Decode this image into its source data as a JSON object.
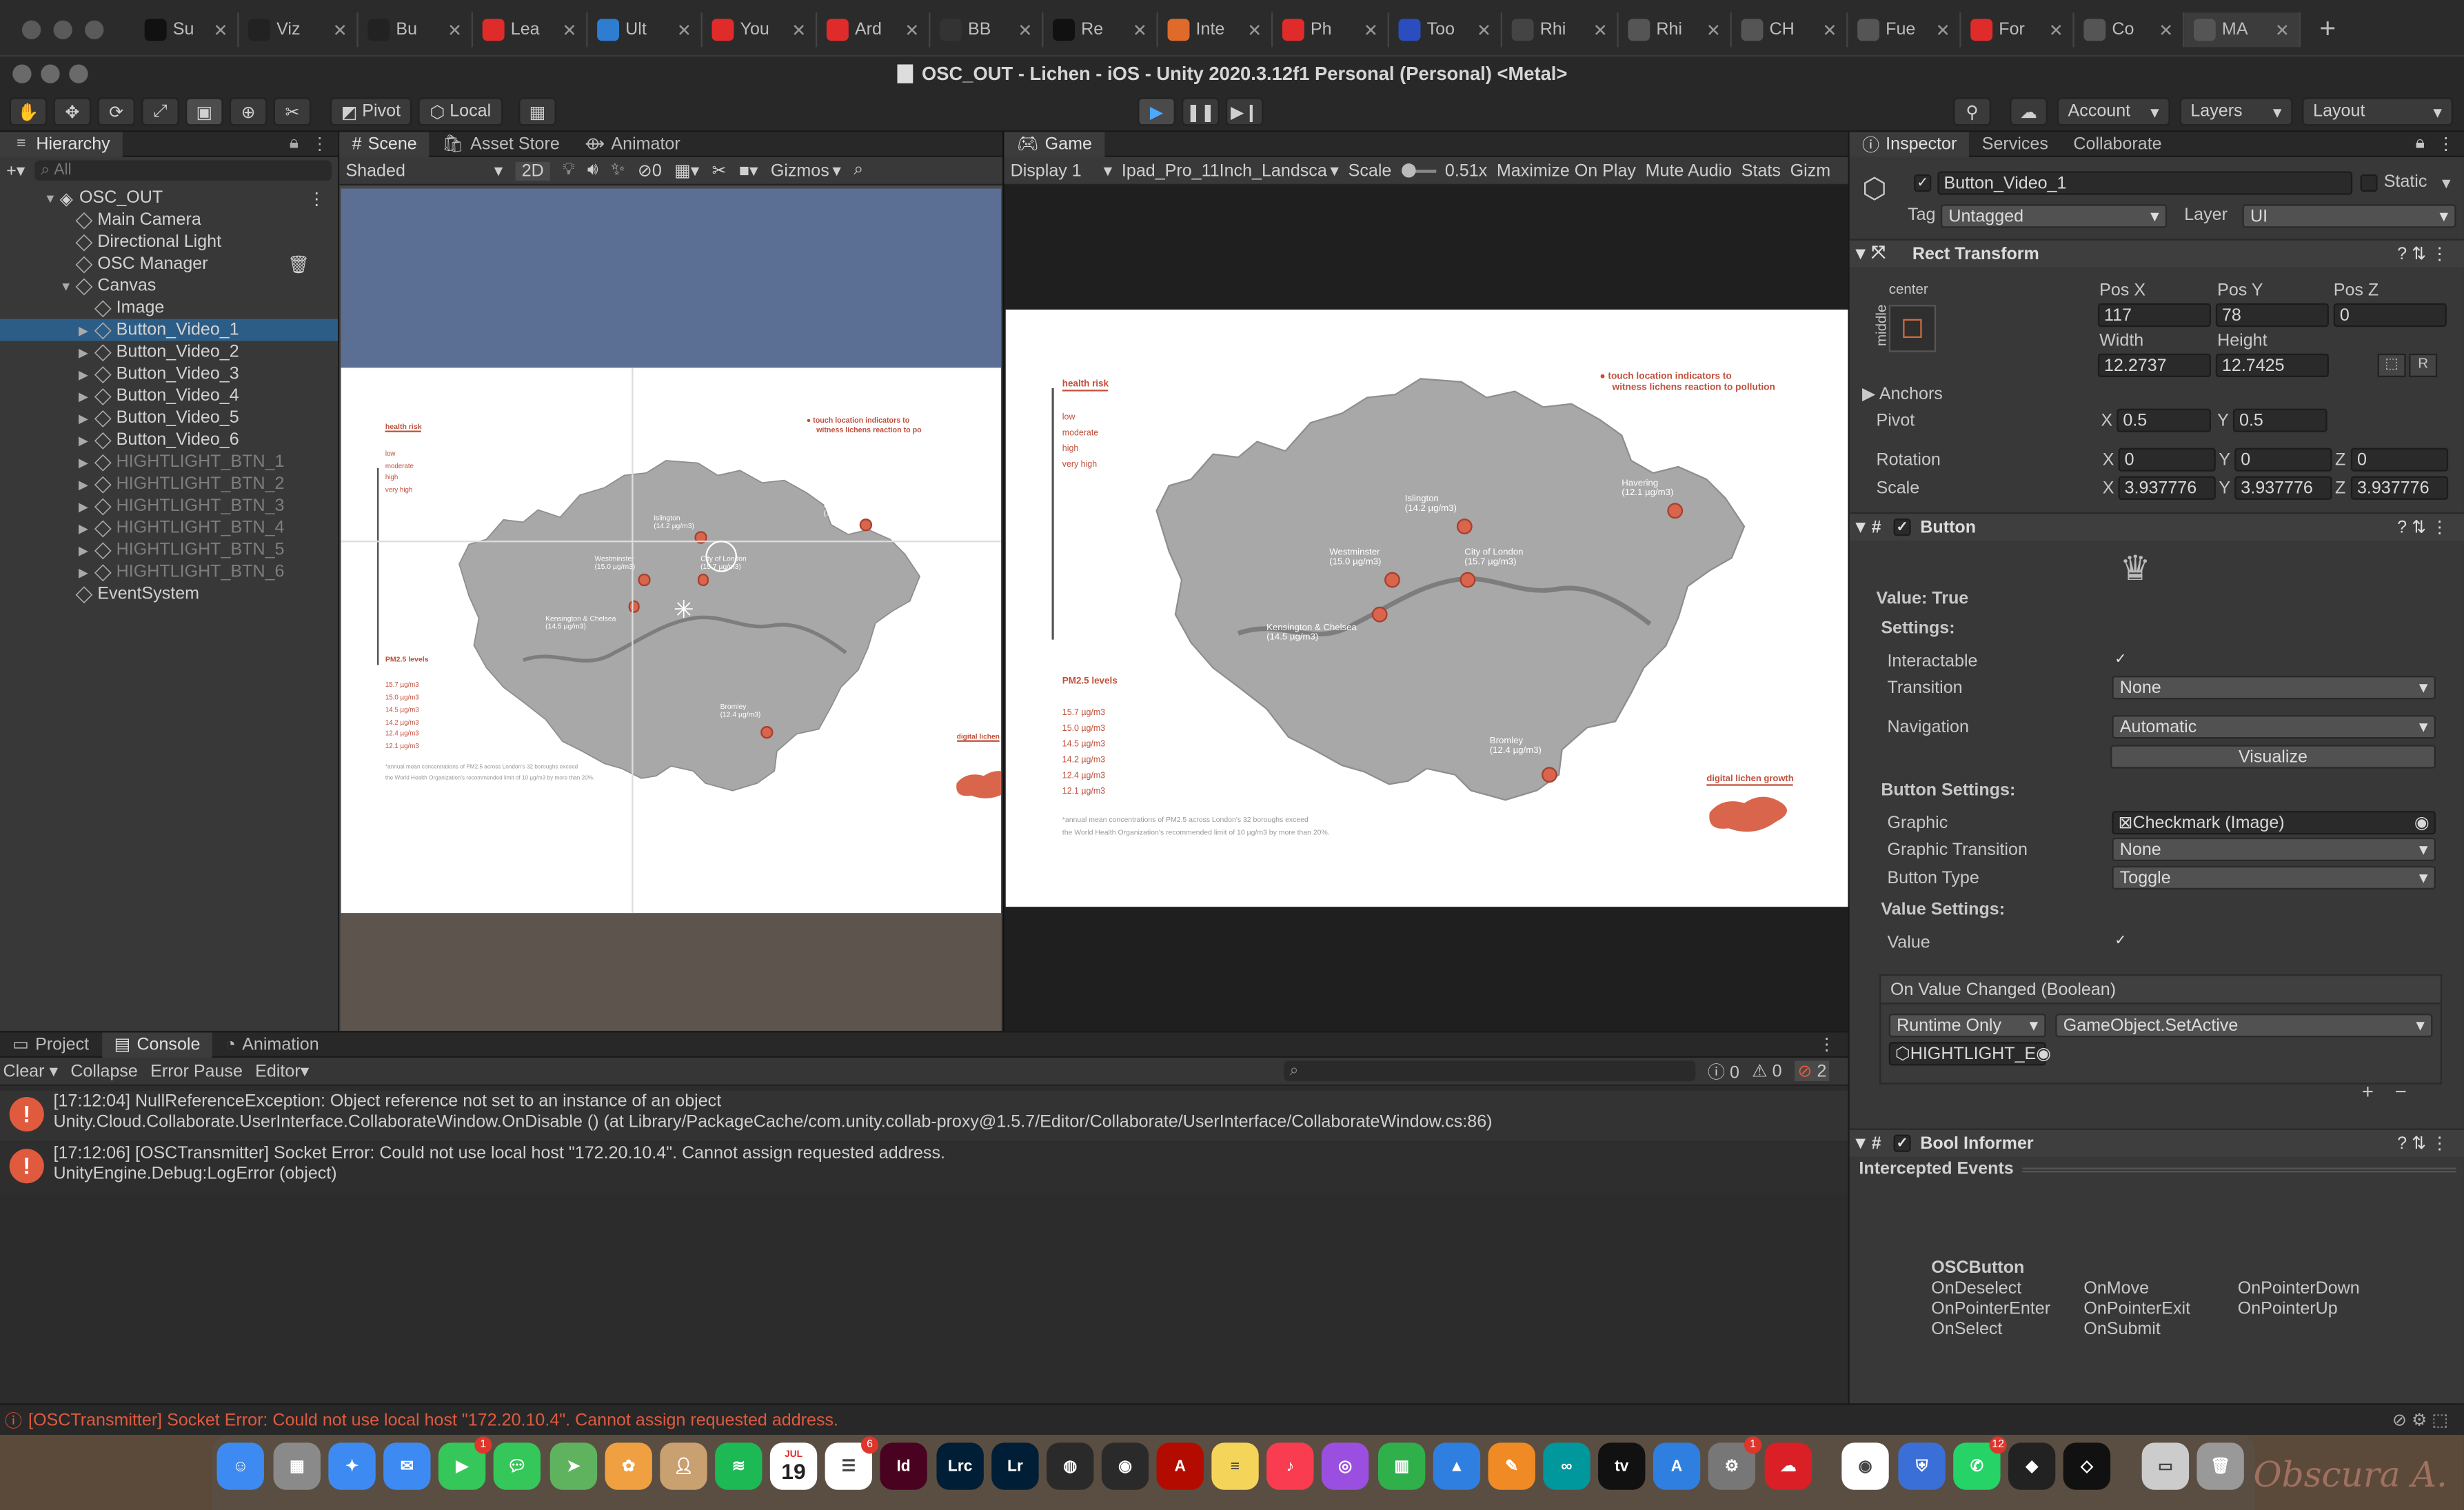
{
  "browser_tabs": [
    {
      "label": "Su",
      "fav": "J",
      "color": "#111"
    },
    {
      "label": "Viz",
      "fav": "gh",
      "color": "#222"
    },
    {
      "label": "Bu",
      "fav": "G",
      "color": "#222"
    },
    {
      "label": "Lea",
      "fav": "yt",
      "color": "#e02b2b"
    },
    {
      "label": "Ult",
      "fav": "u",
      "color": "#2e7dd1"
    },
    {
      "label": "You",
      "fav": "yt",
      "color": "#e02b2b"
    },
    {
      "label": "Ard",
      "fav": "yt",
      "color": "#e02b2b"
    },
    {
      "label": "BB",
      "fav": "bb",
      "color": "#333"
    },
    {
      "label": "Re",
      "fav": "J",
      "color": "#111"
    },
    {
      "label": "Inte",
      "fav": "i",
      "color": "#e06a2a"
    },
    {
      "label": "Ph",
      "fav": "yt",
      "color": "#e02b2b"
    },
    {
      "label": "Too",
      "fav": "t",
      "color": "#2a4ec0"
    },
    {
      "label": "Rhi",
      "fav": "r",
      "color": "#444"
    },
    {
      "label": "Rhi",
      "fav": "r",
      "color": "#555"
    },
    {
      "label": "CH",
      "fav": "c",
      "color": "#555"
    },
    {
      "label": "Fue",
      "fav": "f",
      "color": "#555"
    },
    {
      "label": "For",
      "fav": "yt",
      "color": "#e02b2b"
    },
    {
      "label": "Co",
      "fav": "o",
      "color": "#555"
    },
    {
      "label": "MA",
      "fav": "m",
      "color": "#555"
    }
  ],
  "window_title": "OSC_OUT - Lichen - iOS - Unity 2020.3.12f1 Personal (Personal) <Metal>",
  "toolbar": {
    "pivot": "Pivot",
    "local": "Local",
    "account": "Account",
    "layers": "Layers",
    "layout": "Layout"
  },
  "hierarchy": {
    "tab": "Hierarchy",
    "search_placeholder": "All",
    "scene": "OSC_OUT",
    "items": [
      {
        "label": "Main Camera",
        "depth": 1
      },
      {
        "label": "Directional Light",
        "depth": 1
      },
      {
        "label": "OSC Manager",
        "depth": 1
      },
      {
        "label": "Canvas",
        "depth": 1
      },
      {
        "label": "Image",
        "depth": 2
      },
      {
        "label": "Button_Video_1",
        "depth": 2
      },
      {
        "label": "Button_Video_2",
        "depth": 2
      },
      {
        "label": "Button_Video_3",
        "depth": 2
      },
      {
        "label": "Button_Video_4",
        "depth": 2
      },
      {
        "label": "Button_Video_5",
        "depth": 2
      },
      {
        "label": "Button_Video_6",
        "depth": 2
      },
      {
        "label": "HIGHTLIGHT_BTN_1",
        "depth": 2
      },
      {
        "label": "HIGHTLIGHT_BTN_2",
        "depth": 2
      },
      {
        "label": "HIGHTLIGHT_BTN_3",
        "depth": 2
      },
      {
        "label": "HIGHTLIGHT_BTN_4",
        "depth": 2
      },
      {
        "label": "HIGHTLIGHT_BTN_5",
        "depth": 2
      },
      {
        "label": "HIGHTLIGHT_BTN_6",
        "depth": 2
      },
      {
        "label": "EventSystem",
        "depth": 1
      }
    ]
  },
  "scene_view": {
    "tabs": [
      "Scene",
      "Asset Store",
      "Animator"
    ],
    "shading": "Shaded",
    "mode_2d": "2D",
    "gizmos": "Gizmos",
    "hidden_count": "0"
  },
  "game_view": {
    "tab": "Game",
    "display": "Display 1",
    "resolution": "Ipad_Pro_11Inch_Landsca",
    "scale_label": "Scale",
    "scale_value": "0.51x",
    "maximize": "Maximize On Play",
    "mute": "Mute Audio",
    "stats": "Stats",
    "gizmos": "Gizm"
  },
  "map": {
    "risk_title": "health risk",
    "risk_levels": [
      "low",
      "moderate",
      "high",
      "very high"
    ],
    "touch_note_1": "touch location indicators to",
    "touch_note_2": "witness lichens reaction to pollution",
    "touch_note_2_scene": "witness lichens reaction to po",
    "pm_title": "PM2.5 levels",
    "pm_levels": [
      "15.7 µg/m3",
      "15.0 µg/m3",
      "14.5 µg/m3",
      "14.2 µg/m3",
      "12.4 µg/m3",
      "12.1 µg/m3"
    ],
    "footnote_1": "*annual mean concentrations of PM2.5 across London's 32 boroughs exceed",
    "footnote_2": "the World Health Organization's recommended limit of 10 µg/m3 by more than 20%.",
    "growth": "digital lichen growth",
    "growth_scene": "digital lichen",
    "places": [
      {
        "name": "Islington",
        "value": "(14.2 µg/m3)"
      },
      {
        "name": "Westminster",
        "value": "(15.0 µg/m3)"
      },
      {
        "name": "City of London",
        "value": "(15.7 µg/m3)"
      },
      {
        "name": "Kensington & Chelsea",
        "value": "(14.5 µg/m3)"
      },
      {
        "name": "Havering",
        "value": "(12.1 µg/m3)"
      },
      {
        "name": "Bromley",
        "value": "(12.4 µg/m3)"
      }
    ]
  },
  "inspector": {
    "tabs": [
      "Inspector",
      "Services",
      "Collaborate"
    ],
    "object_name": "Button_Video_1",
    "static": "Static",
    "tag_label": "Tag",
    "tag": "Untagged",
    "layer_label": "Layer",
    "layer": "UI",
    "rect": {
      "title": "Rect Transform",
      "anchor": "center",
      "side": "middle",
      "posx_l": "Pos X",
      "posy_l": "Pos Y",
      "posz_l": "Pos Z",
      "posx": "117",
      "posy": "78",
      "posz": "0",
      "width_l": "Width",
      "height_l": "Height",
      "width": "12.2737",
      "height": "12.7425",
      "anchors": "Anchors",
      "pivot": "Pivot",
      "pivot_x": "0.5",
      "pivot_y": "0.5",
      "rotation": "Rotation",
      "rot_x": "0",
      "rot_y": "0",
      "rot_z": "0",
      "scale": "Scale",
      "scale_x": "3.937776",
      "scale_y": "3.937776",
      "scale_z": "3.937776",
      "x": "X",
      "y": "Y",
      "z": "Z",
      "r": "R"
    },
    "button": {
      "title": "Button",
      "value_line": "Value: True",
      "settings": "Settings:",
      "interactable": "Interactable",
      "transition": "Transition",
      "transition_v": "None",
      "navigation": "Navigation",
      "navigation_v": "Automatic",
      "visualize": "Visualize",
      "button_settings": "Button Settings:",
      "graphic": "Graphic",
      "graphic_v": "Checkmark (Image)",
      "graphic_transition": "Graphic Transition",
      "graphic_transition_v": "None",
      "button_type": "Button Type",
      "button_type_v": "Toggle",
      "value_settings": "Value Settings:",
      "value": "Value",
      "on_value_changed": "On Value Changed (Boolean)",
      "runtime": "Runtime Only",
      "method": "GameObject.SetActive",
      "target": "HIGHTLIGHT_E"
    },
    "bool_informer": {
      "title": "Bool Informer",
      "intercepted": "Intercepted Events",
      "header": "OSCButton",
      "col1": [
        "OnDeselect",
        "OnPointerEnter",
        "OnSelect"
      ],
      "col2": [
        "OnMove",
        "OnPointerExit",
        "OnSubmit"
      ],
      "col3": [
        "OnPointerDown",
        "OnPointerUp"
      ]
    }
  },
  "console": {
    "tabs": [
      "Project",
      "Console",
      "Animation"
    ],
    "clear": "Clear",
    "collapse": "Collapse",
    "error_pause": "Error Pause",
    "editor": "Editor",
    "count_info": "0",
    "count_warn": "0",
    "count_err": "2",
    "logs": [
      {
        "line1": "[17:12:04] NullReferenceException: Object reference not set to an instance of an object",
        "line2": "Unity.Cloud.Collaborate.UserInterface.CollaborateWindow.OnDisable () (at Library/PackageCache/com.unity.collab-proxy@1.5.7/Editor/Collaborate/UserInterface/CollaborateWindow.cs:86)"
      },
      {
        "line1": "[17:12:06] [OSCTransmitter] Socket Error: Could not use local host \"172.20.10.4\". Cannot assign requested address.",
        "line2": "UnityEngine.Debug:LogError (object)"
      }
    ]
  },
  "status": "[OSCTransmitter] Socket Error: Could not use local host \"172.20.10.4\". Cannot assign requested address.",
  "dock": {
    "calendar_month": "JUL",
    "calendar_day": "19",
    "badge_1": "1",
    "badge_2": "6",
    "badge_3": "1",
    "badge_4": "12",
    "watermark": "Obscura A."
  }
}
